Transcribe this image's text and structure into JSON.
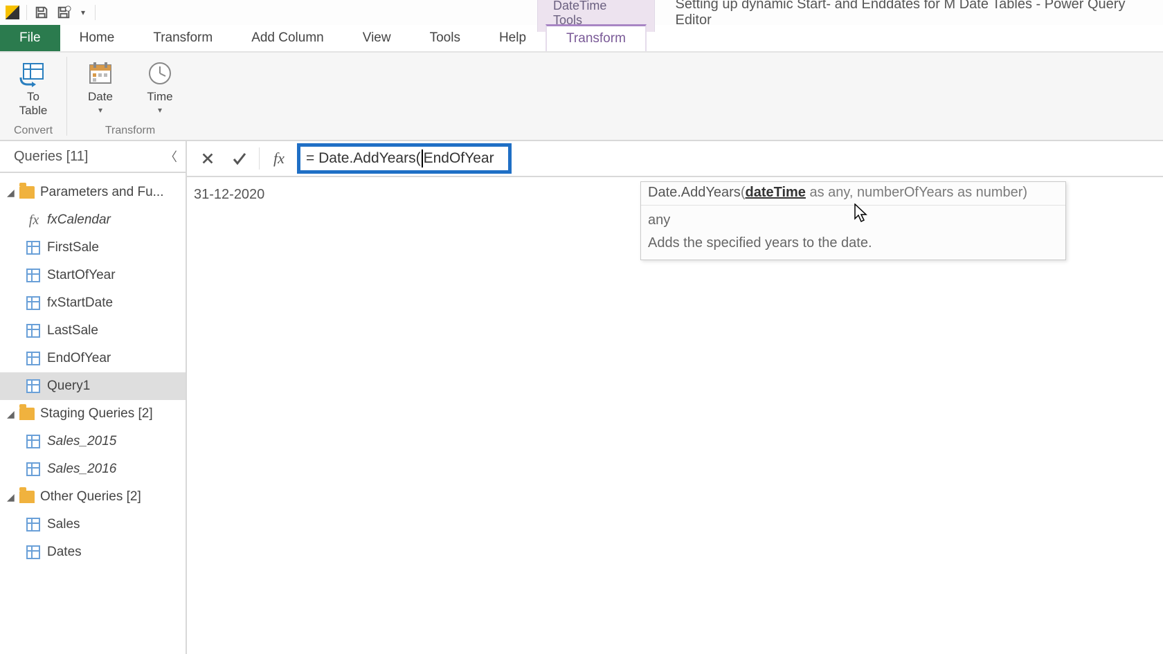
{
  "titlebar": {
    "context_tool_tab": "DateTime Tools",
    "window_title": "Setting up dynamic Start- and Enddates for M Date Tables - Power Query Editor"
  },
  "ribbon_tabs": {
    "file": "File",
    "home": "Home",
    "transform": "Transform",
    "add_column": "Add Column",
    "view": "View",
    "tools": "Tools",
    "help": "Help",
    "context_transform": "Transform"
  },
  "ribbon": {
    "to_table": "To\nTable",
    "date": "Date",
    "time": "Time",
    "group_convert": "Convert",
    "group_transform": "Transform"
  },
  "queries_pane": {
    "header": "Queries [11]",
    "groups": [
      {
        "label": "Parameters and Fu...",
        "items": [
          {
            "label": "fxCalendar",
            "type": "fx",
            "italic": true
          },
          {
            "label": "FirstSale",
            "type": "table"
          },
          {
            "label": "StartOfYear",
            "type": "table"
          },
          {
            "label": "fxStartDate",
            "type": "table"
          },
          {
            "label": "LastSale",
            "type": "table"
          },
          {
            "label": "EndOfYear",
            "type": "table"
          },
          {
            "label": "Query1",
            "type": "table",
            "selected": true
          }
        ]
      },
      {
        "label": "Staging Queries [2]",
        "items": [
          {
            "label": "Sales_2015",
            "type": "table",
            "italic": true
          },
          {
            "label": "Sales_2016",
            "type": "table",
            "italic": true
          }
        ]
      },
      {
        "label": "Other Queries [2]",
        "items": [
          {
            "label": "Sales",
            "type": "table"
          },
          {
            "label": "Dates",
            "type": "table"
          }
        ]
      }
    ]
  },
  "formula_bar": {
    "prefix": "= Date.AddYears(",
    "suffix": " EndOfYear"
  },
  "result": {
    "value": "31-12-2020"
  },
  "tooltip": {
    "fn_name": "Date.AddYears",
    "sig_open": "(",
    "param_active": "dateTime",
    "sig_rest": " as any, numberOfYears as number)",
    "type_line": "any",
    "description": "Adds the specified years to the date."
  }
}
